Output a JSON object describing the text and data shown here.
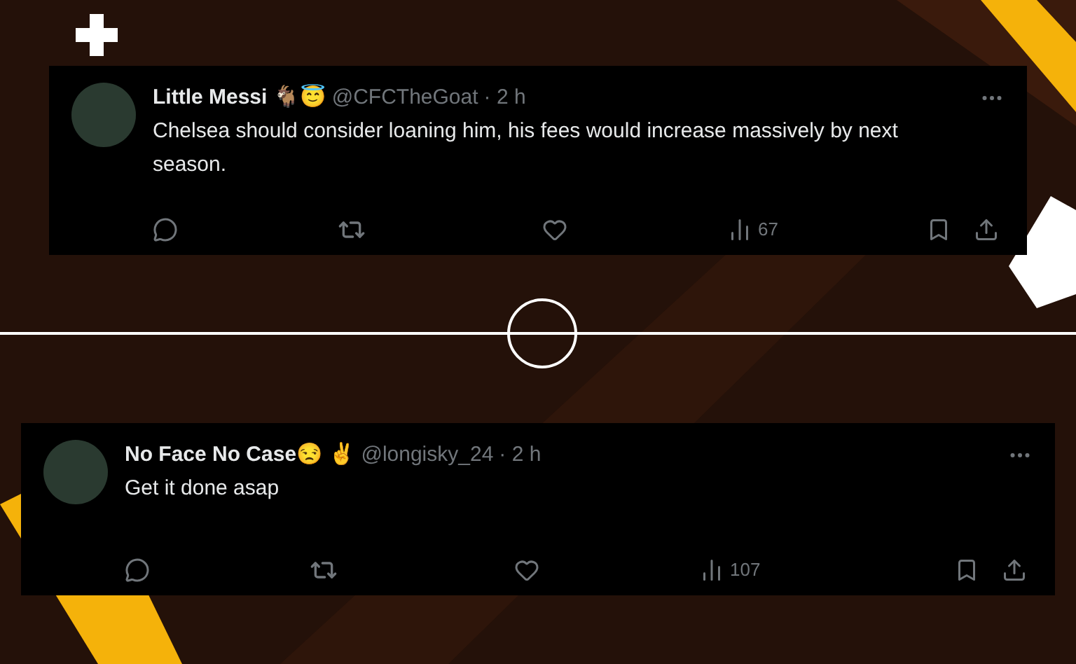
{
  "tweets": [
    {
      "name": "Little Messi 🐐😇",
      "handle": "@CFCTheGoat",
      "time": "· 2 h",
      "text": "Chelsea should consider loaning him, his fees would increase massively by next season.",
      "views": "67"
    },
    {
      "name": "No Face No Case😒 ✌️",
      "handle": "@longisky_24",
      "time": "· 2 h",
      "text": "Get it done asap",
      "views": "107"
    }
  ]
}
